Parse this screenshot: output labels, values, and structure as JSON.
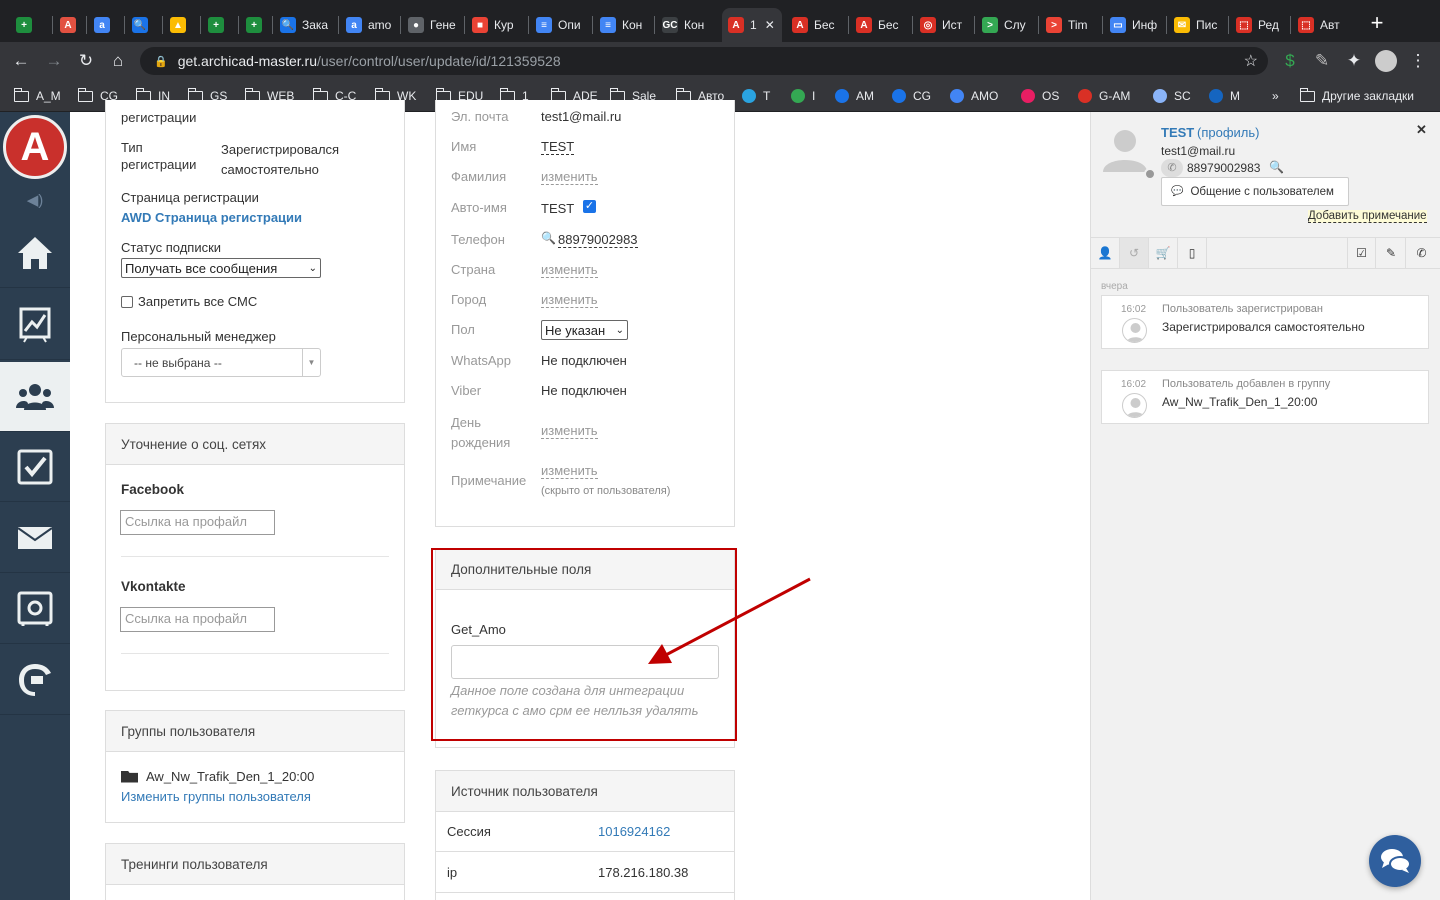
{
  "browser": {
    "tabs": [
      {
        "label": "",
        "color": "#1e8e3e",
        "glyph": "+"
      },
      {
        "label": "",
        "color": "#e25141",
        "glyph": "A"
      },
      {
        "label": "",
        "color": "#4285f4",
        "glyph": "a"
      },
      {
        "label": "",
        "color": "#1a73e8",
        "glyph": "🔍"
      },
      {
        "label": "",
        "color": "#fbbc04",
        "glyph": "▲"
      },
      {
        "label": "",
        "color": "#1e8e3e",
        "glyph": "+"
      },
      {
        "label": "",
        "color": "#1e8e3e",
        "glyph": "+"
      },
      {
        "label": "Зака",
        "color": "#1a73e8",
        "glyph": "🔍"
      },
      {
        "label": "amo",
        "color": "#4285f4",
        "glyph": "a"
      },
      {
        "label": "Гене",
        "color": "#5f6368",
        "glyph": "●"
      },
      {
        "label": "Кур",
        "color": "#ea4335",
        "glyph": "■"
      },
      {
        "label": "Опи",
        "color": "#4285f4",
        "glyph": "≡"
      },
      {
        "label": "Кон",
        "color": "#4285f4",
        "glyph": "≡"
      },
      {
        "label": "Кон",
        "color": "#3c4043",
        "glyph": "GC"
      },
      {
        "label": "1",
        "color": "#d93025",
        "glyph": "A"
      },
      {
        "label": "Бес",
        "color": "#d93025",
        "glyph": "A"
      },
      {
        "label": "Бес",
        "color": "#d93025",
        "glyph": "A"
      },
      {
        "label": "Ист",
        "color": "#d93025",
        "glyph": "◎"
      },
      {
        "label": "Слу",
        "color": "#34a853",
        "glyph": ">"
      },
      {
        "label": "Tim",
        "color": "#ea4335",
        "glyph": ">"
      },
      {
        "label": "Инф",
        "color": "#4285f4",
        "glyph": "▭"
      },
      {
        "label": "Пис",
        "color": "#fbbc04",
        "glyph": "✉"
      },
      {
        "label": "Ред",
        "color": "#d93025",
        "glyph": "⬚"
      },
      {
        "label": "Авт",
        "color": "#d93025",
        "glyph": "⬚"
      }
    ],
    "url_host": "get.archicad-master.ru",
    "url_path": "/user/control/user/update/id/121359528",
    "bookmarks": [
      {
        "label": "A_M",
        "type": "folder"
      },
      {
        "label": "CG",
        "type": "folder"
      },
      {
        "label": "IN",
        "type": "folder"
      },
      {
        "label": "GS",
        "type": "folder"
      },
      {
        "label": "WEB",
        "type": "folder"
      },
      {
        "label": "C-C",
        "type": "folder"
      },
      {
        "label": "WK",
        "type": "folder"
      },
      {
        "label": "EDU",
        "type": "folder"
      },
      {
        "label": "1",
        "type": "folder"
      },
      {
        "label": "ADE",
        "type": "folder"
      },
      {
        "label": "Sale",
        "type": "folder"
      },
      {
        "label": "Авто",
        "type": "folder"
      },
      {
        "label": "T",
        "type": "icon",
        "color": "#2aa3e0"
      },
      {
        "label": "I",
        "type": "icon",
        "color": "#34a853"
      },
      {
        "label": "AM",
        "type": "icon",
        "color": "#1a73e8"
      },
      {
        "label": "CG",
        "type": "icon",
        "color": "#1a73e8"
      },
      {
        "label": "AMO",
        "type": "icon",
        "color": "#4285f4"
      },
      {
        "label": "OS",
        "type": "icon",
        "color": "#e91e63"
      },
      {
        "label": "G-AM",
        "type": "icon",
        "color": "#d93025"
      },
      {
        "label": "SC",
        "type": "icon",
        "color": "#8ab4f8"
      },
      {
        "label": "M",
        "type": "icon",
        "color": "#1565c0"
      }
    ],
    "more": "»",
    "other_bookmarks": "Другие закладки"
  },
  "col1": {
    "reg_cut": "регистрации",
    "reg_type_label1": "Тип",
    "reg_type_label2": "регистрации",
    "reg_type_val1": "Зарегистрировался",
    "reg_type_val2": "самостоятельно",
    "reg_page_label": "Страница регистрации",
    "reg_page_link": "AWD Страница регистрации",
    "sub_status_label": "Статус подписки",
    "sub_status_value": "Получать все сообщения",
    "sms_label": "Запретить все СМС",
    "manager_label": "Персональный менеджер",
    "manager_value": "-- не выбрана --",
    "social_title": "Уточнение о соц. сетях",
    "facebook_label": "Facebook",
    "profile_placeholder": "Ссылка на профайл",
    "vk_label": "Vkontakte",
    "groups_title": "Группы пользователя",
    "group_name": "Aw_Nw_Trafik_Den_1_20:00",
    "change_groups": "Изменить группы пользователя",
    "trainings_title": "Тренинги пользователя"
  },
  "col2": {
    "email_label": "Эл. почта",
    "email_value": "test1@mail.ru",
    "name_label": "Имя",
    "name_value": "TEST",
    "lastname_label": "Фамилия",
    "change": "изменить",
    "autoname_label": "Авто-имя",
    "autoname_value": "TEST",
    "phone_label": "Телефон",
    "phone_value": "88979002983",
    "country_label": "Страна",
    "city_label": "Город",
    "gender_label": "Пол",
    "gender_value": "Не указан",
    "whatsapp_label": "WhatsApp",
    "whatsapp_value": "Не подключен",
    "viber_label": "Viber",
    "viber_value": "Не подключен",
    "birthday_label1": "День",
    "birthday_label2": "рождения",
    "note_label": "Примечание",
    "note_hint": "(скрыто от пользователя)",
    "extra_title": "Дополнительные поля",
    "get_amo_label": "Get_Amo",
    "get_amo_value": "",
    "get_amo_hint1": "Данное поле создана для интеграции",
    "get_amo_hint2": "геткурса с амо срм ее нелльзя удалять",
    "source_title": "Источник пользователя",
    "session_label": "Сессия",
    "session_value": "1016924162",
    "ip_label": "ip",
    "ip_value": "178.216.180.38"
  },
  "right": {
    "user_name": "TEST",
    "profile_link": "(профиль)",
    "email": "test1@mail.ru",
    "phone": "88979002983",
    "chat_button": "Общение с пользователем",
    "add_note": "Добавить примечание",
    "day_label": "вчера",
    "events": [
      {
        "time": "16:02",
        "title": "Пользователь зарегистрирован",
        "text": "Зарегистрировался самостоятельно"
      },
      {
        "time": "16:02",
        "title": "Пользователь добавлен в группу",
        "text": "Aw_Nw_Trafik_Den_1_20:00"
      }
    ]
  },
  "colors": {
    "highlight": "#c00000",
    "sidebar": "#2c3e50",
    "link": "#337ab7"
  }
}
